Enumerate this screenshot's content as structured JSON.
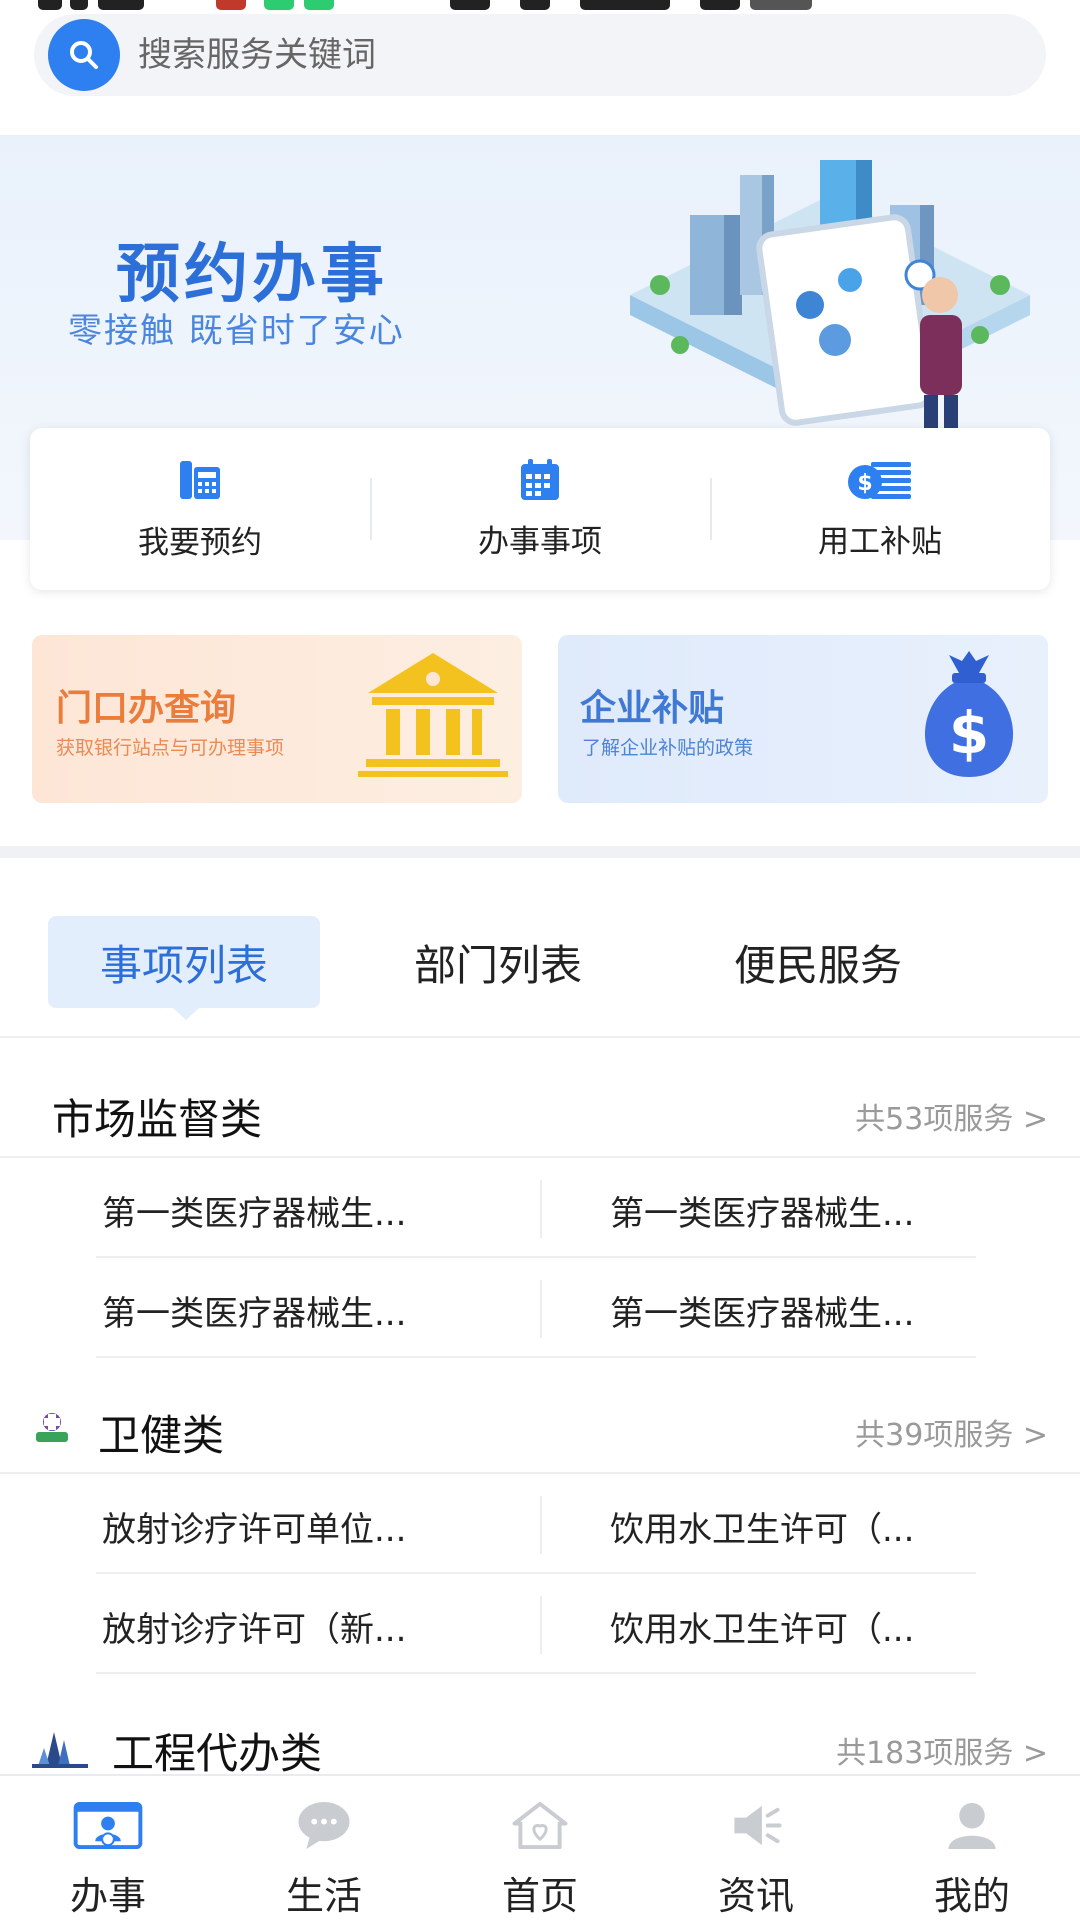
{
  "search": {
    "placeholder": "搜索服务关键词"
  },
  "banner": {
    "title": "预约办事",
    "subtitle": "零接触  既省时了安心"
  },
  "quick_actions": [
    {
      "label": "我要预约",
      "icon": "phone-icon"
    },
    {
      "label": "办事事项",
      "icon": "calendar-icon"
    },
    {
      "label": "用工补贴",
      "icon": "money-icon"
    }
  ],
  "promos": [
    {
      "title": "门口办查询",
      "desc": "获取银行站点与可办理事项",
      "icon": "bank-icon"
    },
    {
      "title": "企业补贴",
      "desc": "了解企业补贴的政策",
      "icon": "money-bag-icon"
    }
  ],
  "tabs": [
    "事项列表",
    "部门列表",
    "便民服务"
  ],
  "categories": [
    {
      "title": "市场监督类",
      "count": "共53项服务 >",
      "items": [
        "第一类医疗器械生...",
        "第一类医疗器械生...",
        "第一类医疗器械生...",
        "第一类医疗器械生..."
      ]
    },
    {
      "title": "卫健类",
      "count": "共39项服务 >",
      "items": [
        "放射诊疗许可单位...",
        "饮用水卫生许可（...",
        "放射诊疗许可（新...",
        "饮用水卫生许可（..."
      ]
    },
    {
      "title": "工程代办类",
      "count": "共183项服务 >",
      "items": []
    }
  ],
  "nav": [
    {
      "label": "办事",
      "icon": "affairs-icon",
      "active": true
    },
    {
      "label": "生活",
      "icon": "chat-bubble-icon"
    },
    {
      "label": "首页",
      "icon": "home-icon"
    },
    {
      "label": "资讯",
      "icon": "megaphone-icon"
    },
    {
      "label": "我的",
      "icon": "user-icon"
    }
  ],
  "colors": {
    "accent": "#2e7ff0",
    "orange": "#ea7d3c",
    "gold": "#f4c21f"
  }
}
